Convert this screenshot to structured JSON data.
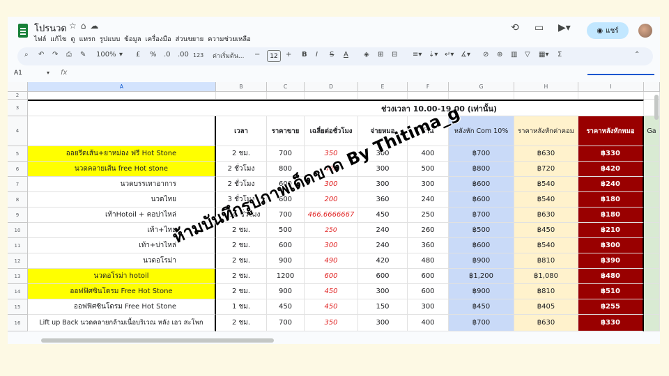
{
  "doc": {
    "title": "โปรนวด",
    "menu": [
      "ไฟล์",
      "แก้ไข",
      "ดู",
      "แทรก",
      "รูปแบบ",
      "ข้อมูล",
      "เครื่องมือ",
      "ส่วนขยาย",
      "ความช่วยเหลือ"
    ],
    "share_label": "แชร์"
  },
  "toolbar": {
    "zoom": "100%",
    "currency": "£",
    "percent": "%",
    "dec_minus": ".0",
    "dec_plus": ".00",
    "number_format": "123",
    "font": "ค่าเริ่มต้น...",
    "font_size": "12"
  },
  "formula_bar": {
    "name_box": "A1",
    "fx": "fx"
  },
  "columns": [
    "A",
    "B",
    "C",
    "D",
    "E",
    "F",
    "G",
    "H",
    "I",
    ""
  ],
  "rows": [
    {
      "num": "2",
      "cells": [
        "",
        "",
        "",
        "",
        "",
        "",
        "",
        "",
        "",
        ""
      ]
    },
    {
      "num": "3",
      "title": "ช่วงเวลา 10.00-19.00 (เท่านั้น)"
    },
    {
      "num": "4",
      "cells": [
        "",
        "เวลา",
        "ราคาขาย",
        "เฉลี่ยต่อชั่วโมง",
        "จ่ายหมอ",
        "ร้าน",
        "หลังหัก Com 10%",
        "ราคาหลังหักค่าคอม",
        "ราคาหลังหักหมอ",
        "Ga"
      ]
    },
    {
      "num": "5",
      "cells": [
        "ออยรีดเส้น+ยาหม่อง ฟรี Hot Stone",
        "2 ชม.",
        "700",
        "350",
        "300",
        "400",
        "฿700",
        "฿630",
        "฿330",
        ""
      ]
    },
    {
      "num": "6",
      "cells": [
        "นวดคลายเส้น free Hot stone",
        "2 ชั่วโมง",
        "800",
        "400",
        "300",
        "500",
        "฿800",
        "฿720",
        "฿420",
        ""
      ]
    },
    {
      "num": "7",
      "cells": [
        "นวดบรรเทาอาการ",
        "2 ชั่วโมง",
        "600",
        "300",
        "300",
        "300",
        "฿600",
        "฿540",
        "฿240",
        ""
      ]
    },
    {
      "num": "8",
      "cells": [
        "นวดไทย",
        "3 ชั่วโมง",
        "600",
        "200",
        "360",
        "240",
        "฿600",
        "฿540",
        "฿180",
        ""
      ]
    },
    {
      "num": "9",
      "cells": [
        "เท้าHotoil + คอบ่าไหล่",
        "1.30 ชั่วโมง",
        "700",
        "466.6666667",
        "450",
        "250",
        "฿700",
        "฿630",
        "฿180",
        ""
      ]
    },
    {
      "num": "10",
      "cells": [
        "เท้า+ไทย",
        "2 ชม.",
        "500",
        "250",
        "240",
        "260",
        "฿500",
        "฿450",
        "฿210",
        ""
      ]
    },
    {
      "num": "11",
      "cells": [
        "เท้า+บ่าไหล่",
        "2 ชม.",
        "600",
        "300",
        "240",
        "360",
        "฿600",
        "฿540",
        "฿300",
        ""
      ]
    },
    {
      "num": "12",
      "cells": [
        "นวดอโรม่า",
        "2 ชม.",
        "900",
        "490",
        "420",
        "480",
        "฿900",
        "฿810",
        "฿390",
        ""
      ]
    },
    {
      "num": "13",
      "cells": [
        "นวดอโรม่า hotoil",
        "2 ชม.",
        "1200",
        "600",
        "600",
        "600",
        "฿1,200",
        "฿1,080",
        "฿480",
        ""
      ]
    },
    {
      "num": "14",
      "cells": [
        "ออฟฟิศซินโดรม Free Hot Stone",
        "2 ชม.",
        "900",
        "450",
        "300",
        "600",
        "฿900",
        "฿810",
        "฿510",
        ""
      ]
    },
    {
      "num": "15",
      "cells": [
        "ออฟฟิศซินโดรม Free Hot Stone",
        "1 ชม.",
        "450",
        "450",
        "150",
        "300",
        "฿450",
        "฿405",
        "฿255",
        ""
      ]
    },
    {
      "num": "16",
      "cells": [
        "Lift up Back นวดคลายกล้ามเนื้อบริเวณ หลัง เอว สะโพก",
        "2 ชม.",
        "700",
        "350",
        "300",
        "400",
        "฿700",
        "฿630",
        "฿330",
        ""
      ]
    }
  ],
  "watermark": "ห้ามบันทึกรูปภาพเด็ดขาด By Thitima_g",
  "colors": {
    "yellow": "#ffff00",
    "blue": "#c9daf8",
    "cream": "#fff2cc",
    "maroon": "#990000",
    "red_text": "#e02020"
  }
}
